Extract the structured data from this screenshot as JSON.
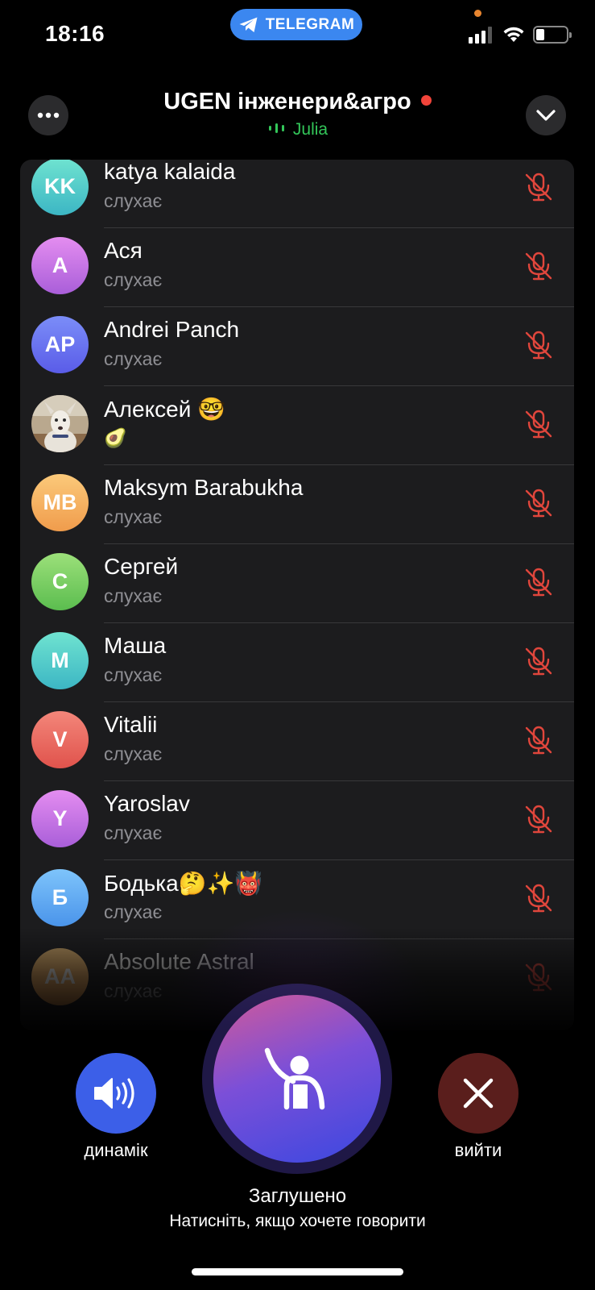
{
  "status_bar": {
    "time": "18:16",
    "app_pill": "TELEGRAM",
    "battery_level": 0.2
  },
  "header": {
    "title": "UGEN інженери&агро",
    "current_speaker": "Julia",
    "recording_color": "#f2443a"
  },
  "participants": [
    {
      "initials": "KK",
      "name": "katya kalaida",
      "status": "слухає",
      "avatar_gradient": [
        "#6fe3d0",
        "#3cb6c4"
      ],
      "muted": true
    },
    {
      "initials": "А",
      "name": "Ася",
      "status": "слухає",
      "avatar_gradient": [
        "#e48df0",
        "#a95ed9"
      ],
      "muted": true
    },
    {
      "initials": "AP",
      "name": "Andrei Panch",
      "status": "слухає",
      "avatar_gradient": [
        "#7b8df8",
        "#5a5ce8"
      ],
      "muted": true
    },
    {
      "initials": "",
      "name": "Алексей 🤓",
      "status": "🥑",
      "avatar_photo": true,
      "muted": true
    },
    {
      "initials": "MB",
      "name": "Maksym Barabukha",
      "status": "слухає",
      "avatar_gradient": [
        "#fbc97a",
        "#f09c4c"
      ],
      "muted": true
    },
    {
      "initials": "С",
      "name": "Сергей",
      "status": "слухає",
      "avatar_gradient": [
        "#9ce07a",
        "#5bbd4f"
      ],
      "muted": true
    },
    {
      "initials": "М",
      "name": "Маша",
      "status": "слухає",
      "avatar_gradient": [
        "#6fe3d0",
        "#3cb6c4"
      ],
      "muted": true
    },
    {
      "initials": "V",
      "name": "Vitalii",
      "status": "слухає",
      "avatar_gradient": [
        "#f3867a",
        "#e0534c"
      ],
      "muted": true
    },
    {
      "initials": "Y",
      "name": "Yaroslav",
      "status": "слухає",
      "avatar_gradient": [
        "#e48df0",
        "#a95ed9"
      ],
      "muted": true
    },
    {
      "initials": "Б",
      "name": "Бодька🤔✨👹",
      "status": "слухає",
      "avatar_gradient": [
        "#7ec4fb",
        "#4a94ea"
      ],
      "muted": true
    },
    {
      "initials": "AA",
      "name": "Absolute Astral",
      "status": "слухає",
      "avatar_gradient": [
        "#fbc97a",
        "#f09c4c"
      ],
      "muted": true
    }
  ],
  "controls": {
    "speaker_label": "динамік",
    "leave_label": "вийти",
    "muted_title": "Заглушено",
    "muted_hint": "Натисніть, якщо хочете говорити"
  },
  "colors": {
    "mic_muted": "#e0463c",
    "speaker_button": "#3c5fe8",
    "leave_button": "#5a1e1c"
  }
}
